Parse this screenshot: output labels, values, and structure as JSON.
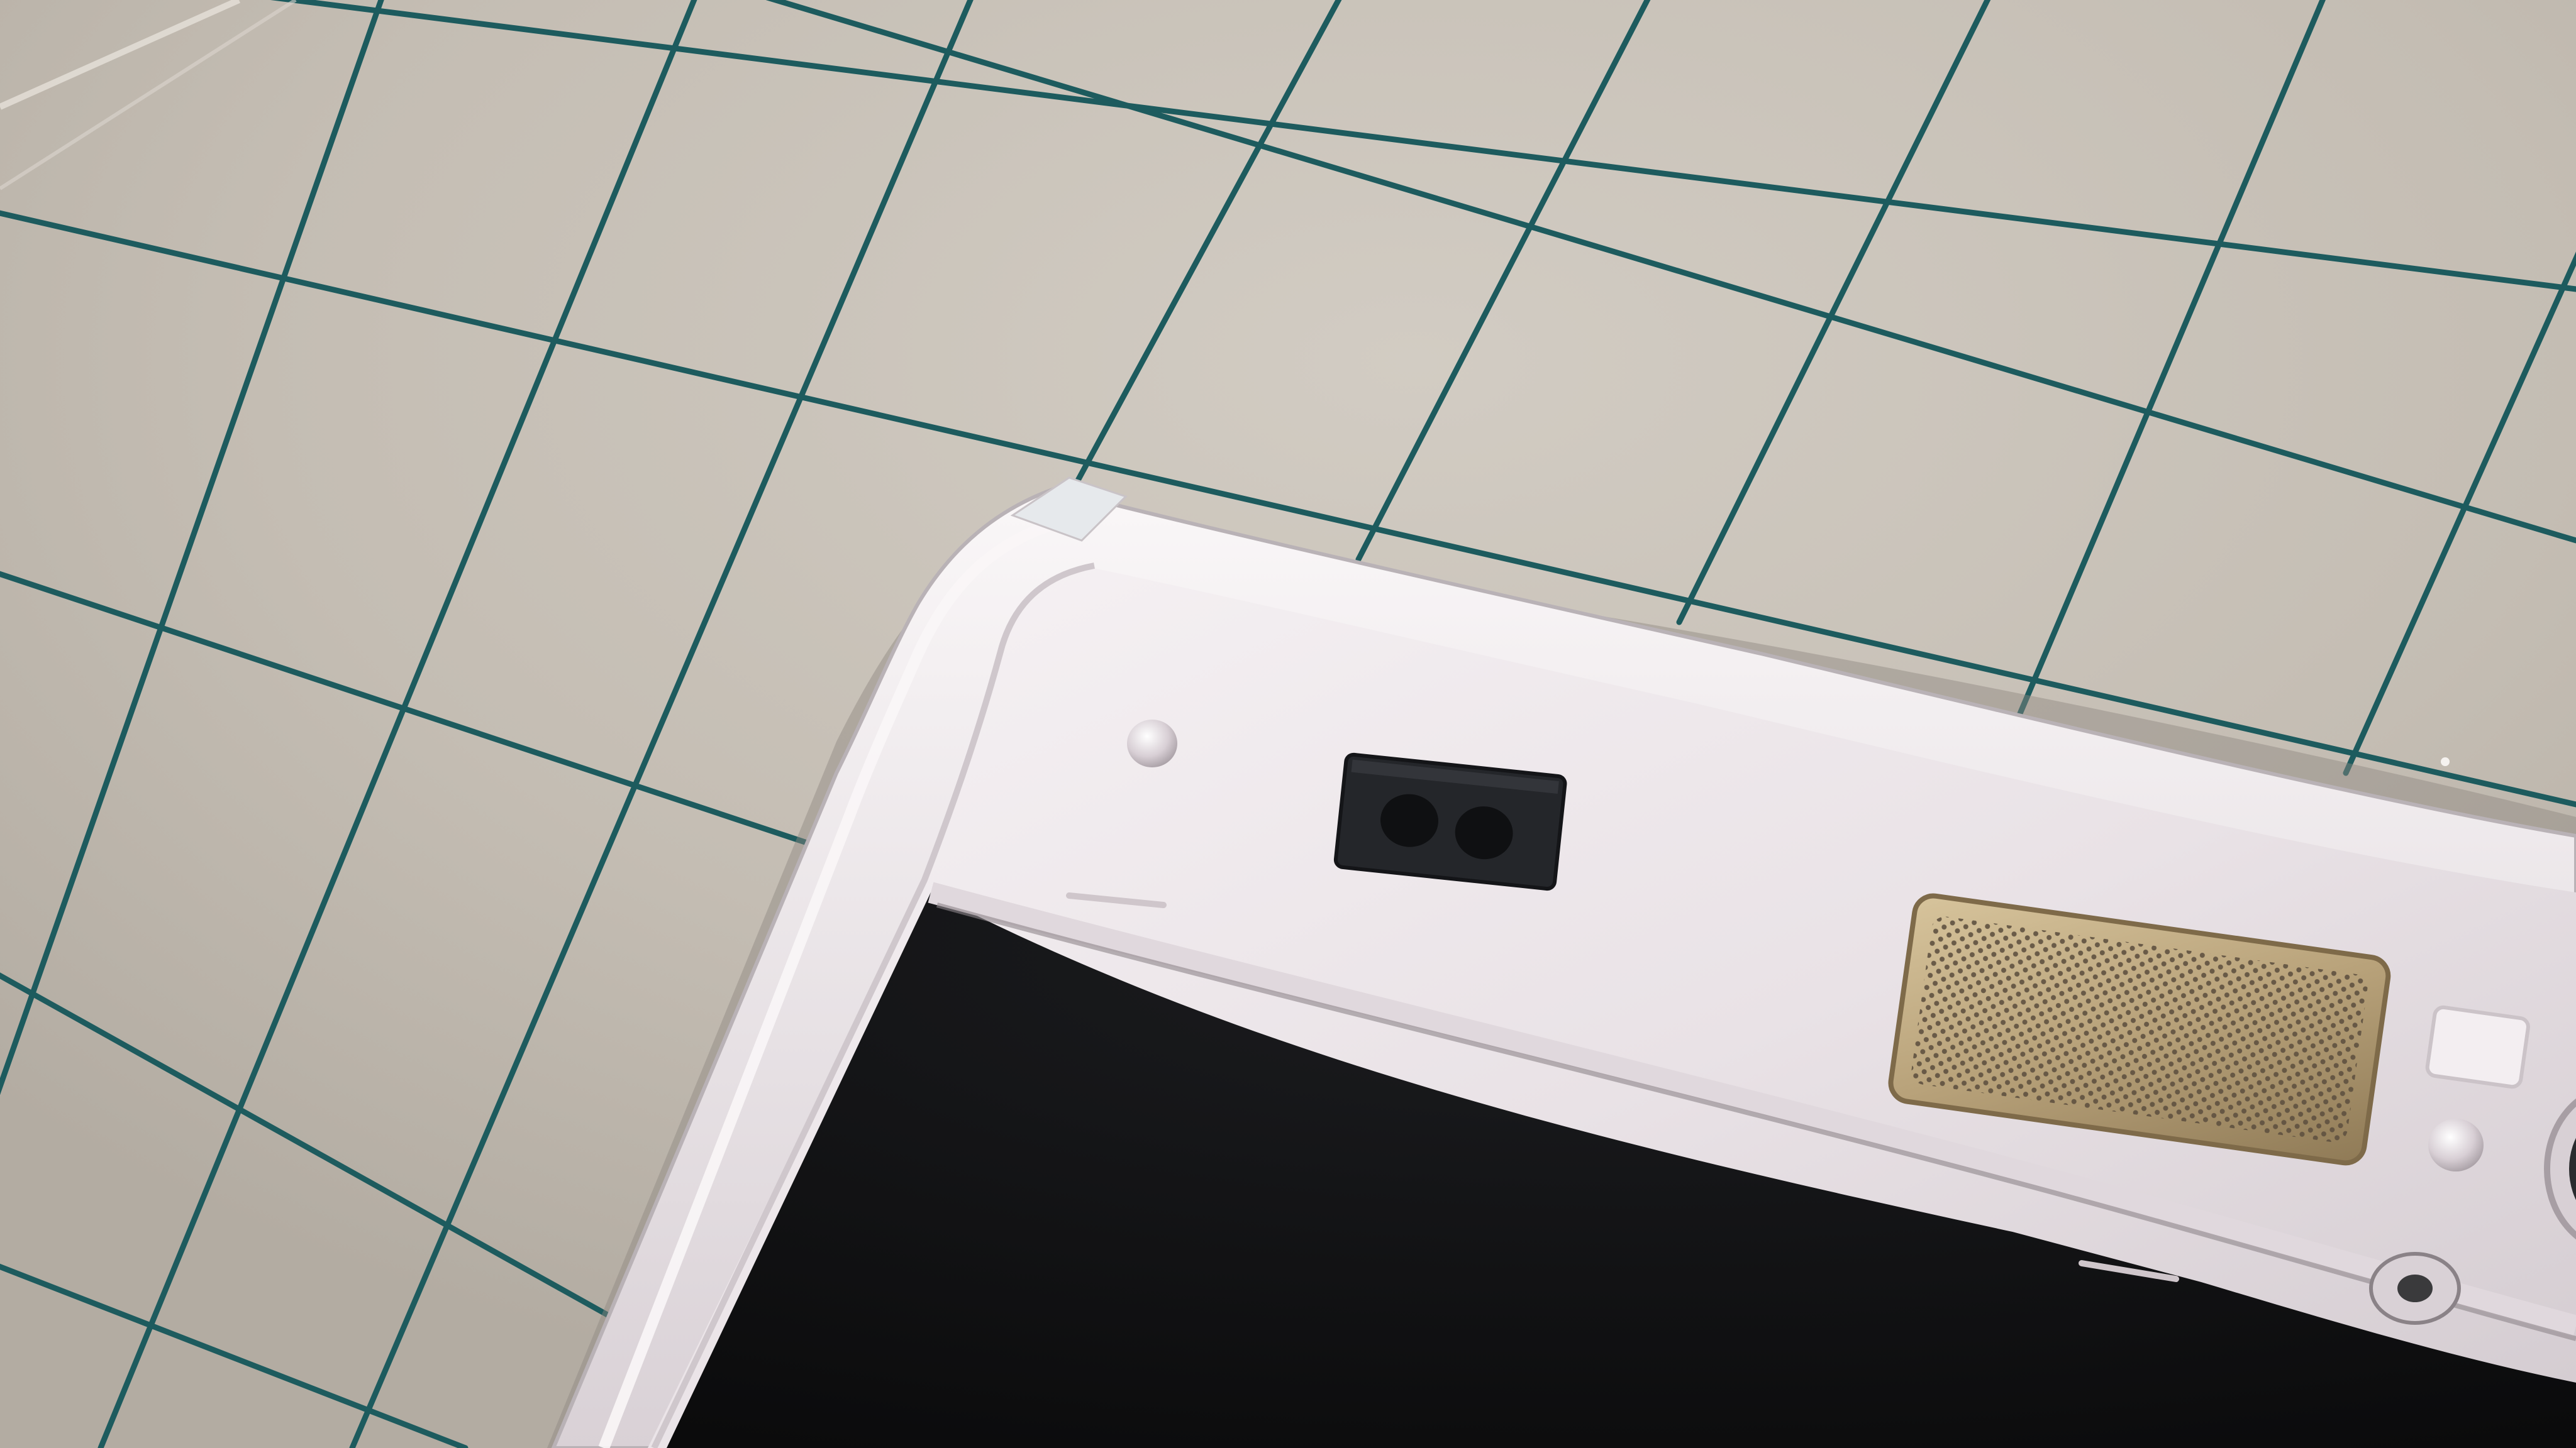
{
  "scene": {
    "subject": "phone-front-frame-on-cutting-mat",
    "colors": {
      "mat": "#c4bdb3",
      "mat_light": "#d2ccc3",
      "mat_shadow": "#b3aca2",
      "grid_line": "#1d5b5e",
      "frame_white": "#e9e2e6",
      "frame_shadow": "#b9b2b6",
      "frame_highlight": "#f7f3f5",
      "screen_black": "#111214",
      "sensor_black": "#24262a",
      "grille_gold": "#b8a27a",
      "grille_dot": "#5f5140"
    },
    "elements": [
      {
        "name": "cutting-mat",
        "kind": "surface"
      },
      {
        "name": "grid-lines",
        "kind": "printed-grid"
      },
      {
        "name": "phone-frame",
        "kind": "plastic-bezel"
      },
      {
        "name": "display-panel",
        "kind": "screen-opening"
      },
      {
        "name": "proximity-sensor",
        "kind": "rubber-gasket"
      },
      {
        "name": "earpiece-grille",
        "kind": "metal-mesh"
      },
      {
        "name": "camera-hole",
        "kind": "round-opening"
      }
    ]
  }
}
